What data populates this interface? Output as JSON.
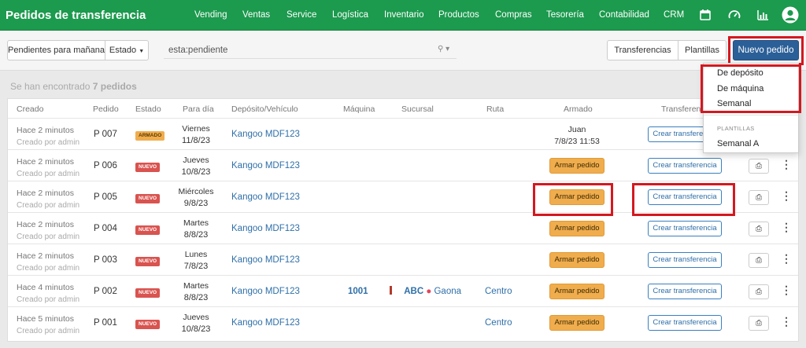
{
  "app": {
    "title": "Pedidos de transferencia",
    "nav": [
      "Vending",
      "Ventas",
      "Service",
      "Logística",
      "Inventario",
      "Productos",
      "Compras",
      "Tesorería",
      "Contabilidad",
      "CRM"
    ],
    "nav_icons": [
      "calendar-icon",
      "speedometer-icon",
      "bar-chart-icon",
      "user-avatar-icon"
    ]
  },
  "toolbar": {
    "filter_label": "Pendientes para mañana",
    "estado_label": "Estado",
    "search_value": "esta:pendiente",
    "transferencias_label": "Transferencias",
    "plantillas_label": "Plantillas",
    "nuevo_pedido_label": "Nuevo pedido"
  },
  "results": {
    "prefix": "Se han encontrado",
    "count": "7 pedidos"
  },
  "table": {
    "columns": [
      "Creado",
      "Pedido",
      "Estado",
      "Para día",
      "Depósito/Vehículo",
      "Máquina",
      "Sucursal",
      "Ruta",
      "Armado",
      "Transferencias"
    ],
    "armar_label": "Armar pedido",
    "crear_label": "Crear transferencia",
    "rows": [
      {
        "created": "Hace 2 minutos",
        "created_by": "Creado por admin",
        "pedido": "P 007",
        "estado": "ARMADO",
        "dia": "Viernes",
        "fecha": "11/8/23",
        "deposito": "Kangoo MDF123",
        "maquina": "",
        "sucursal_code": "",
        "sucursal_name": "",
        "ruta": "",
        "armado_by": "Juan",
        "armado_at": "7/8/23 11:53"
      },
      {
        "created": "Hace 2 minutos",
        "created_by": "Creado por admin",
        "pedido": "P 006",
        "estado": "NUEVO",
        "dia": "Jueves",
        "fecha": "10/8/23",
        "deposito": "Kangoo MDF123",
        "maquina": "",
        "sucursal_code": "",
        "sucursal_name": "",
        "ruta": ""
      },
      {
        "created": "Hace 2 minutos",
        "created_by": "Creado por admin",
        "pedido": "P 005",
        "estado": "NUEVO",
        "dia": "Miércoles",
        "fecha": "9/8/23",
        "deposito": "Kangoo MDF123",
        "maquina": "",
        "sucursal_code": "",
        "sucursal_name": "",
        "ruta": ""
      },
      {
        "created": "Hace 2 minutos",
        "created_by": "Creado por admin",
        "pedido": "P 004",
        "estado": "NUEVO",
        "dia": "Martes",
        "fecha": "8/8/23",
        "deposito": "Kangoo MDF123",
        "maquina": "",
        "sucursal_code": "",
        "sucursal_name": "",
        "ruta": ""
      },
      {
        "created": "Hace 2 minutos",
        "created_by": "Creado por admin",
        "pedido": "P 003",
        "estado": "NUEVO",
        "dia": "Lunes",
        "fecha": "7/8/23",
        "deposito": "Kangoo MDF123",
        "maquina": "",
        "sucursal_code": "",
        "sucursal_name": "",
        "ruta": ""
      },
      {
        "created": "Hace 4 minutos",
        "created_by": "Creado por admin",
        "pedido": "P 002",
        "estado": "NUEVO",
        "dia": "Martes",
        "fecha": "8/8/23",
        "deposito": "Kangoo MDF123",
        "maquina": "1001",
        "sucursal_code": "ABC",
        "sucursal_name": "Gaona",
        "ruta": "Centro"
      },
      {
        "created": "Hace 5 minutos",
        "created_by": "Creado por admin",
        "pedido": "P 001",
        "estado": "NUEVO",
        "dia": "Jueves",
        "fecha": "10/8/23",
        "deposito": "Kangoo MDF123",
        "maquina": "",
        "sucursal_code": "",
        "sucursal_name": "",
        "ruta": "Centro"
      }
    ]
  },
  "dropdown": {
    "items": [
      "De depósito",
      "De máquina",
      "Semanal"
    ],
    "section_header": "PLANTILLAS",
    "template_items": [
      "Semanal A"
    ]
  },
  "colors": {
    "nav_bg": "#1c9a4e",
    "primary": "#2b5f97",
    "highlight": "#d4181f",
    "nuevo": "#d9534f",
    "armado": "#f0ad4e"
  }
}
